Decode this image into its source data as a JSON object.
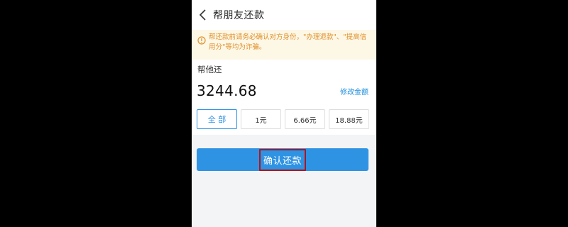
{
  "header": {
    "title": "帮朋友还款",
    "back_icon": "chevron-left-icon"
  },
  "notice": {
    "icon": "warning-icon",
    "text": "帮还款前请务必确认对方身份，\"办理退款\"、\"提高信用分\"等均为诈骗。",
    "color": "#e0912b"
  },
  "payment": {
    "label": "帮他还",
    "amount": "3244.68",
    "modify_label": "修改金额",
    "chips": [
      "全 部",
      "1元",
      "6.66元",
      "18.88元"
    ],
    "selected_chip": "全 部"
  },
  "actions": {
    "confirm_label": "确认还款"
  },
  "colors": {
    "accent": "#2f93e4",
    "highlight_border": "#b0141c",
    "link": "#1a8cde"
  }
}
